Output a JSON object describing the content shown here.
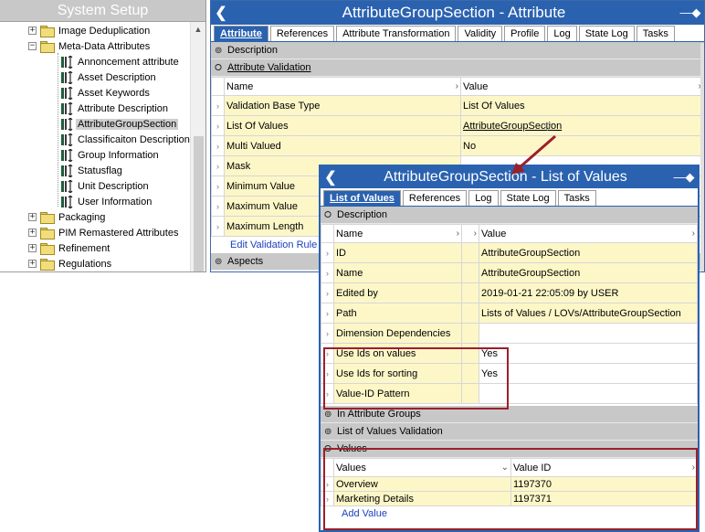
{
  "left_panel": {
    "title": "System Setup",
    "tree": [
      {
        "label": "Image Deduplication",
        "type": "folder",
        "expander": "+"
      },
      {
        "label": "Meta-Data Attributes",
        "type": "folder",
        "expander": "−"
      },
      {
        "label": "Annoncement attribute",
        "type": "attribute"
      },
      {
        "label": "Asset Description",
        "type": "attribute"
      },
      {
        "label": "Asset Keywords",
        "type": "attribute"
      },
      {
        "label": "Attribute Description",
        "type": "attribute"
      },
      {
        "label": "AttributeGroupSection",
        "type": "attribute",
        "selected": true
      },
      {
        "label": "Classificaiton Description",
        "type": "attribute"
      },
      {
        "label": "Group Information",
        "type": "attribute"
      },
      {
        "label": "Statusflag",
        "type": "attribute"
      },
      {
        "label": "Unit Description",
        "type": "attribute"
      },
      {
        "label": "User Information",
        "type": "attribute"
      },
      {
        "label": "Packaging",
        "type": "folder",
        "expander": "+"
      },
      {
        "label": "PIM Remastered Attributes",
        "type": "folder",
        "expander": "+"
      },
      {
        "label": "Refinement",
        "type": "folder",
        "expander": "+"
      },
      {
        "label": "Regulations",
        "type": "folder",
        "expander": "+"
      }
    ]
  },
  "main_panel": {
    "title": "AttributeGroupSection - Attribute",
    "back_icon": "chevron-left-icon",
    "pin_icon": "pin-icon",
    "tabs": [
      "Attribute",
      "References",
      "Attribute Transformation",
      "Validity",
      "Profile",
      "Log",
      "State Log",
      "Tasks"
    ],
    "active_tab": "Attribute",
    "sections": {
      "description": "Description",
      "validation": "Attribute Validation",
      "aspects": "Aspects"
    },
    "grid_headers": {
      "name": "Name",
      "value": "Value"
    },
    "rows": [
      {
        "name": "Validation Base Type",
        "value": "List Of Values"
      },
      {
        "name": "List Of Values",
        "value": "AttributeGroupSection"
      },
      {
        "name": "Multi Valued",
        "value": "No"
      },
      {
        "name": "Mask",
        "value": ""
      },
      {
        "name": "Minimum Value",
        "value": ""
      },
      {
        "name": "Maximum Value",
        "value": ""
      },
      {
        "name": "Maximum Length",
        "value": ""
      }
    ],
    "edit_link": "Edit Validation Rule"
  },
  "popup": {
    "title": "AttributeGroupSection - List of Values",
    "back_icon": "chevron-left-icon",
    "pin_icon": "pin-icon",
    "tabs": [
      "List of Values",
      "References",
      "Log",
      "State Log",
      "Tasks"
    ],
    "active_tab": "List of Values",
    "sections": {
      "description": "Description",
      "in_groups": "In Attribute Groups",
      "lov_validation": "List of Values Validation",
      "values": "Values"
    },
    "grid_headers": {
      "name": "Name",
      "value": "Value"
    },
    "rows": [
      {
        "name": "ID",
        "value": "AttributeGroupSection"
      },
      {
        "name": "Name",
        "value": "AttributeGroupSection"
      },
      {
        "name": "Edited by",
        "value": "2019-01-21 22:05:09 by USER"
      },
      {
        "name": "Path",
        "value": "Lists of Values / LOVs/AttributeGroupSection"
      },
      {
        "name": "Dimension Dependencies",
        "value": ""
      },
      {
        "name": "Use Ids on values",
        "value": "Yes"
      },
      {
        "name": "Use Ids for sorting",
        "value": "Yes"
      },
      {
        "name": "Value-ID Pattern",
        "value": ""
      }
    ],
    "values_headers": {
      "values": "Values",
      "value_id": "Value ID"
    },
    "values_rows": [
      {
        "value": "Overview",
        "id": "1197370"
      },
      {
        "value": "Marketing Details",
        "id": "1197371"
      }
    ],
    "add_link": "Add Value"
  },
  "colors": {
    "header_blue": "#2a62b0",
    "highlight_red": "#9c1f2a",
    "cell_yellow": "#fdf7c8",
    "section_gray": "#c8c8c8"
  }
}
